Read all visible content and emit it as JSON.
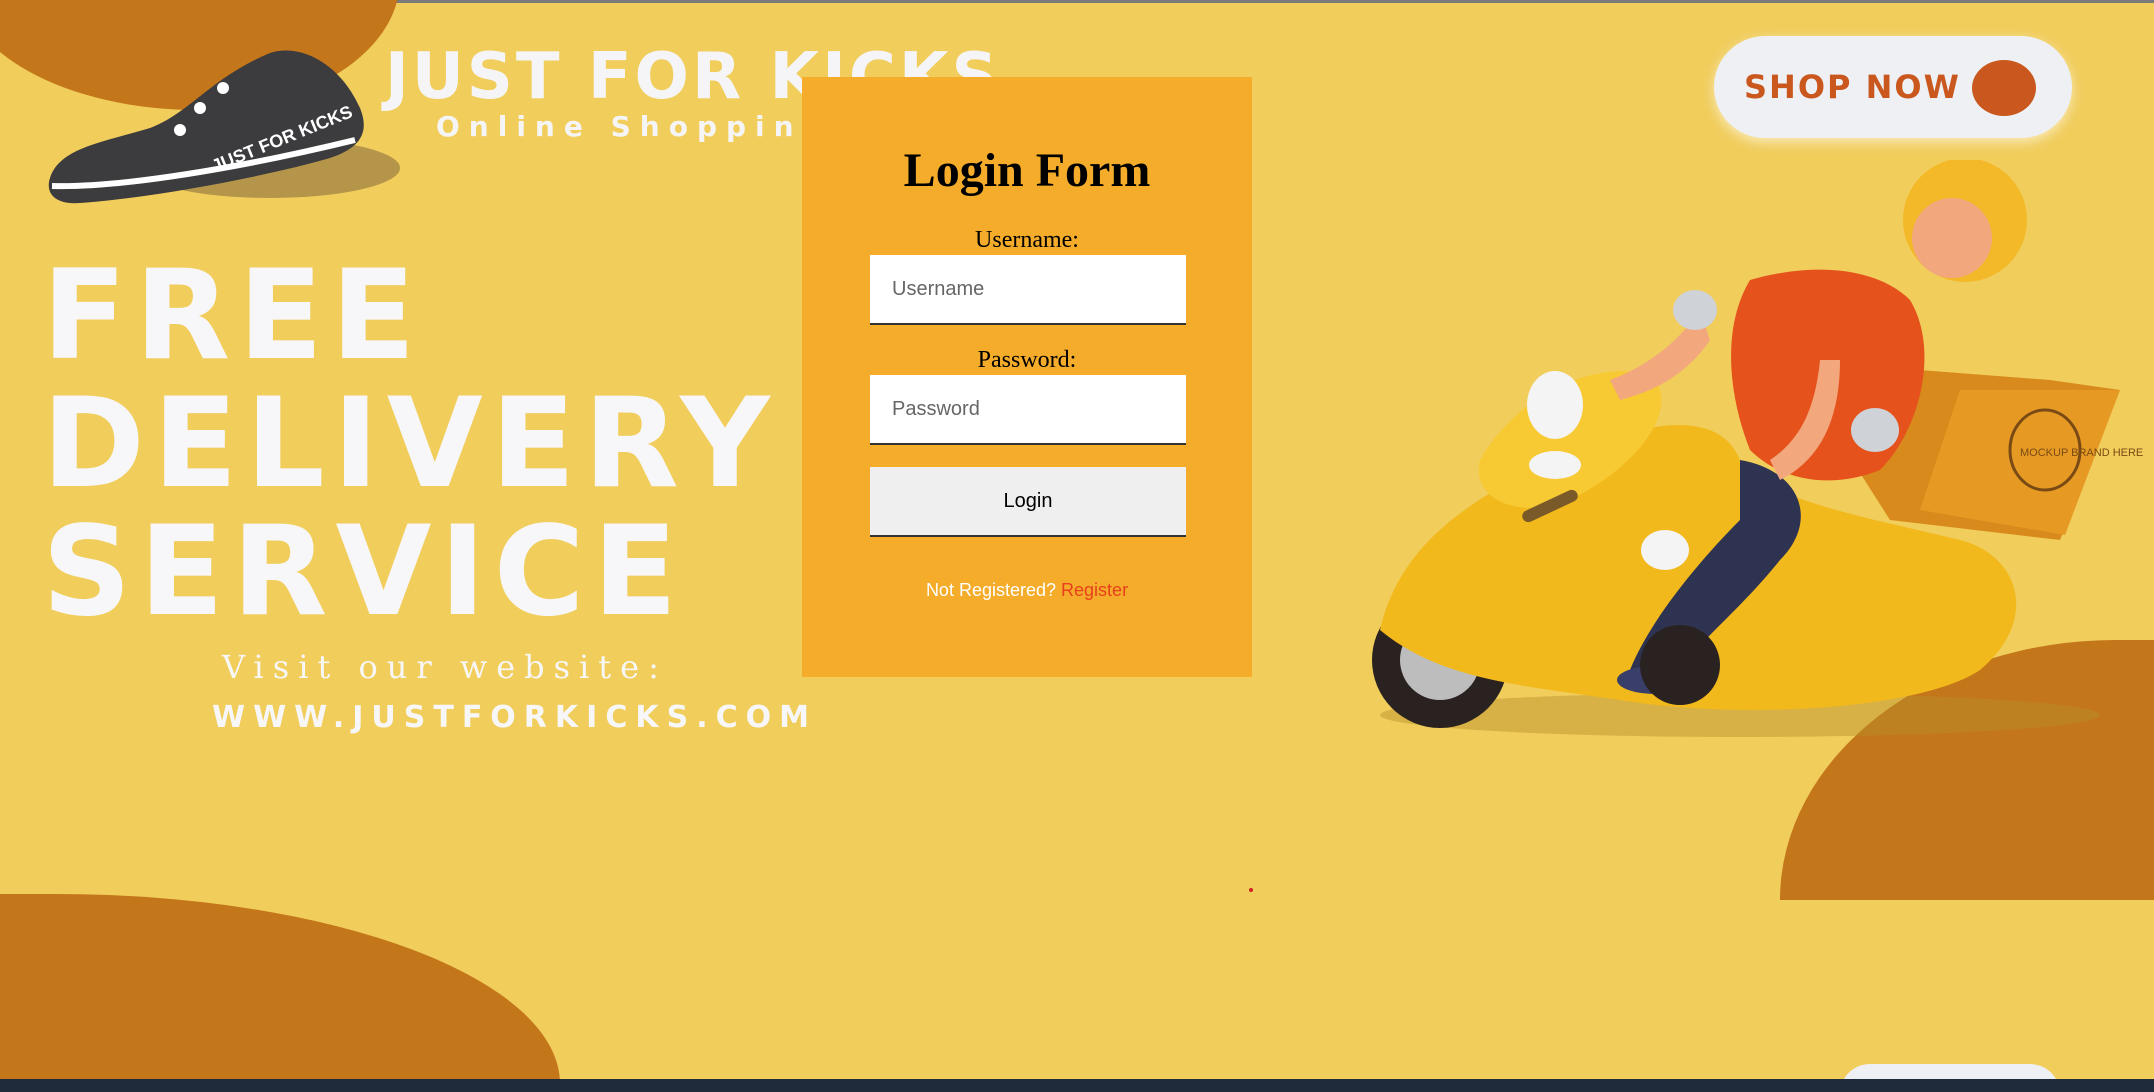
{
  "brand": {
    "title": "JUST FOR KICKS",
    "subtitle": "Online Shopping",
    "shoe_text": "JUST FOR KICKS"
  },
  "hero": {
    "line1": "FREE",
    "line2": "DELIVERY",
    "line3": "SERVICE",
    "visit": "Visit our website:",
    "website": "WWW.JUSTFORKICKS.COM"
  },
  "shop_now": {
    "label": "SHOP NOW"
  },
  "scooter": {
    "box_text": "MOCKUP BRAND HERE"
  },
  "login": {
    "title": "Login Form",
    "username_label": "Username:",
    "username_placeholder": "Username",
    "password_label": "Password:",
    "password_placeholder": "Password",
    "button_label": "Login",
    "not_registered": "Not Registered?",
    "register_link": "Register"
  },
  "colors": {
    "background": "#f1cd5c",
    "accent_dark": "#c4761a",
    "card": "#f4ac2a",
    "link": "#e8401c"
  }
}
